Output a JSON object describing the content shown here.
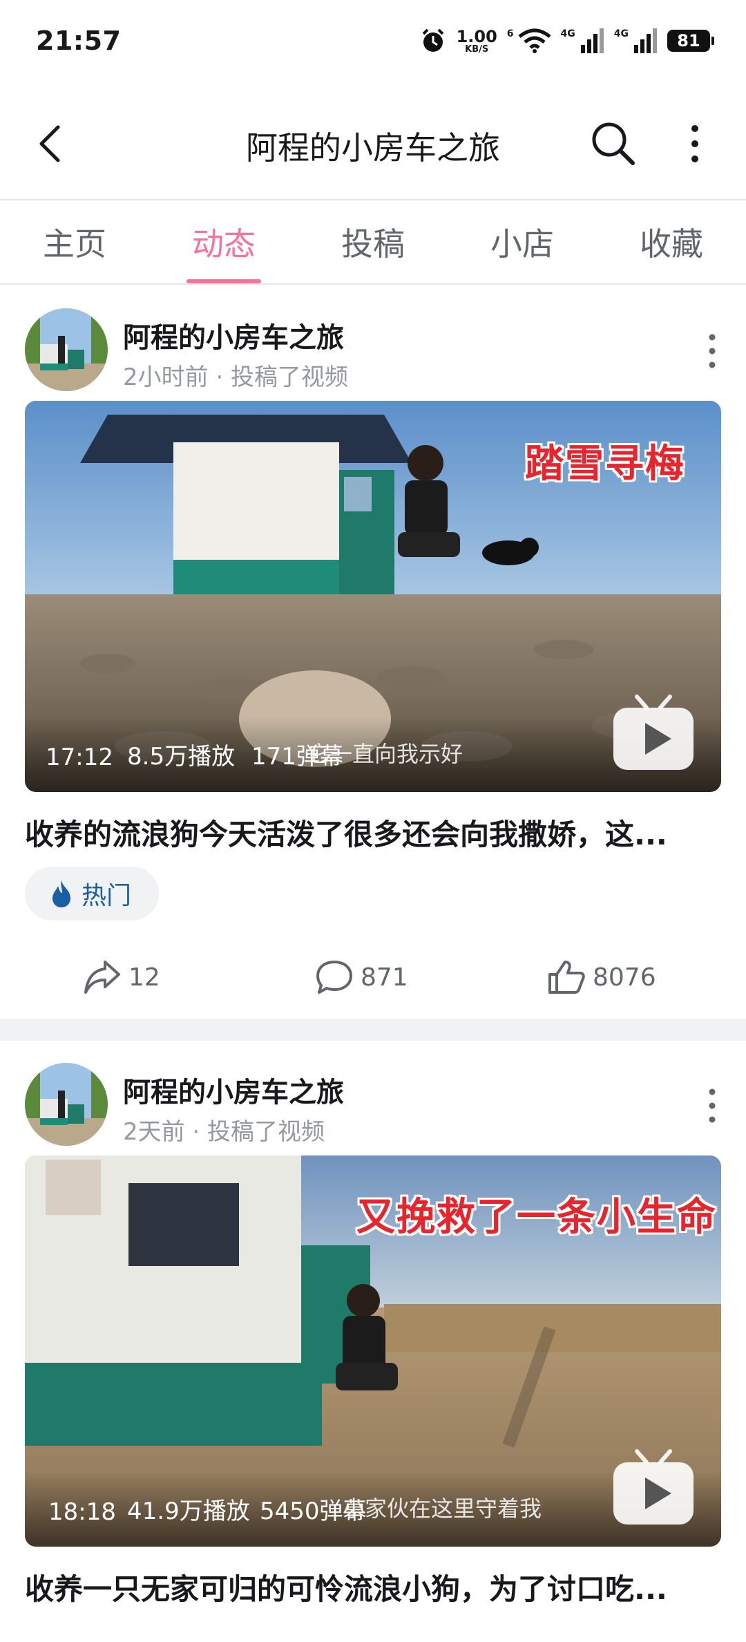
{
  "status": {
    "time": "21:57",
    "net_speed": "1.00",
    "net_unit": "KB/S",
    "net_badge_1": "6",
    "net_badge_2": "4G",
    "net_badge_3": "4G",
    "battery": "81"
  },
  "nav": {
    "title": "阿程的小房车之旅",
    "back_icon": "chevron-left-icon",
    "search_icon": "search-icon",
    "more_icon": "more-vertical-icon"
  },
  "tabs": [
    {
      "label": "主页",
      "active": false
    },
    {
      "label": "动态",
      "active": true
    },
    {
      "label": "投稿",
      "active": false
    },
    {
      "label": "小店",
      "active": false
    },
    {
      "label": "收藏",
      "active": false
    }
  ],
  "accent_color": "#fb7299",
  "posts": [
    {
      "author": "阿程的小房车之旅",
      "meta": "2小时前 · 投稿了视频",
      "overlay_text": "踏雪寻梅",
      "duration": "17:12",
      "views": "8.5万播放",
      "danmaku": "171弹幕",
      "subtitle": "它一直向我示好",
      "title": "收养的流浪狗今天活泼了很多还会向我撒娇，这...",
      "tag": "热门",
      "shares": "12",
      "comments": "871",
      "likes": "8076"
    },
    {
      "author": "阿程的小房车之旅",
      "meta": "2天前 · 投稿了视频",
      "overlay_text": "又挽救了一条小生命",
      "duration": "18:18",
      "views": "41.9万播放",
      "danmaku": "5450弹幕",
      "subtitle": "小家伙在这里守着我",
      "title": "收养一只无家可归的可怜流浪小狗，为了讨口吃..."
    }
  ]
}
